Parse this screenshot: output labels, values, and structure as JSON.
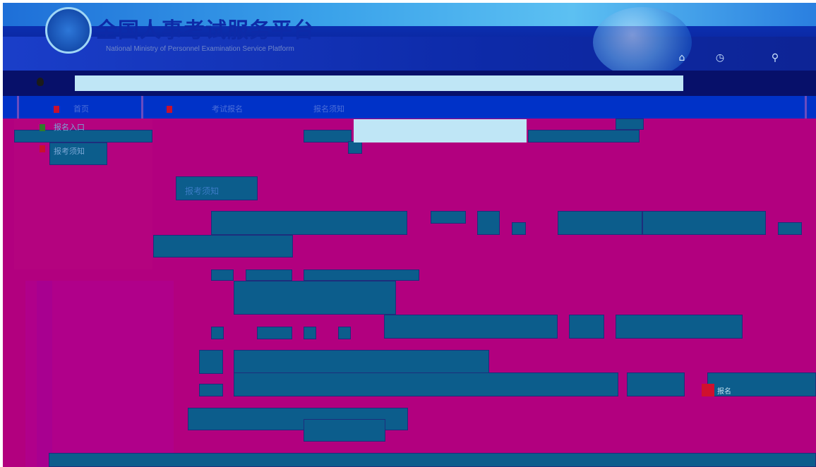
{
  "header": {
    "title": "全国人事考试服务平台",
    "subtitle": "National Ministry of Personnel Examination Service Platform",
    "icons": [
      "home-icon",
      "clock-icon",
      "user-icon"
    ]
  },
  "nav": {
    "search_placeholder": ""
  },
  "breadcrumb": {
    "items": [
      "首页",
      "考试报名",
      "报名须知"
    ]
  },
  "sidebar": {
    "items": [
      "报名入口",
      "报考须知"
    ]
  },
  "main": {
    "filter_placeholder": "",
    "heading": "报考须知",
    "notice_marker": "报名"
  },
  "colors": {
    "header_blue": "#0b2fb0",
    "accent_magenta": "#b2007f",
    "block_teal": "#0c5d8c",
    "input_light": "#bfe6f6"
  }
}
